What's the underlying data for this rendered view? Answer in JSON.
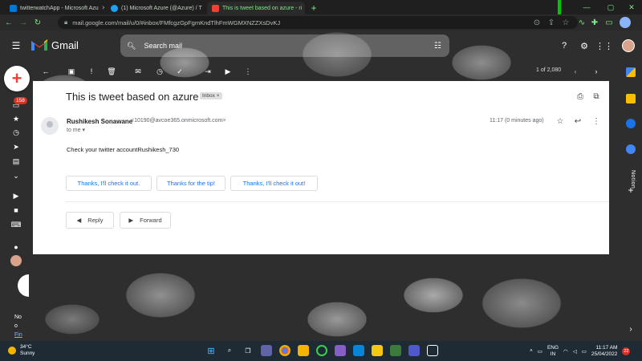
{
  "browser": {
    "tabs": [
      {
        "title": "twitterwatchApp - Microsoft Azu",
        "active": false
      },
      {
        "title": "(1) Microsoft Azure (@Azure) / T",
        "active": false
      },
      {
        "title": "This is tweet based on azure - ri",
        "active": true
      }
    ],
    "new_tab": "+",
    "url": "mail.google.com/mail/u/0/#inbox/FMfcgzGpFgmKndTlhFmWGMXNZZXsDvKJ"
  },
  "gmail": {
    "brand": "Gmail",
    "search_placeholder": "Search mail",
    "pager": "1 of 2,080",
    "unread_badge": "158",
    "side_label": "Notion",
    "sidebar_footer": [
      "No",
      "o",
      "Fin"
    ]
  },
  "email": {
    "subject": "This is tweet based on azure",
    "label": "Inbox ×",
    "sender_name": "Rushikesh Sonawane",
    "sender_email": "<10190@avcoe365.onmicrosoft.com>",
    "to": "to me",
    "time": "11:17 (0 minutes ago)",
    "body": "Check your twitter accountRushikesh_730",
    "smart_replies": [
      "Thanks, I'll check it out.",
      "Thanks for the tip!",
      "Thanks, I'll check it out!"
    ],
    "reply_label": "Reply",
    "forward_label": "Forward"
  },
  "taskbar": {
    "temperature": "34°C",
    "condition": "Sunny",
    "lang_line1": "ENG",
    "lang_line2": "IN",
    "time": "11:17 AM",
    "date": "25/04/2022",
    "notifications": "22"
  },
  "colors": {
    "accent": "#1a73e8",
    "gmail_red": "#ea4335",
    "browser_green": "#7ee787"
  }
}
